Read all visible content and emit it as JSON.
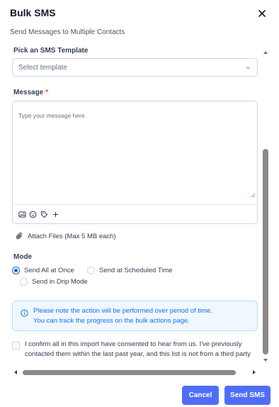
{
  "header": {
    "title": "Bulk SMS",
    "subtitle": "Send Messages to Multiple Contacts",
    "close_icon": "close-icon"
  },
  "template": {
    "label": "Pick an SMS Template",
    "placeholder": "Select template"
  },
  "message": {
    "label": "Message",
    "required_mark": "*",
    "placeholder": "Type your message here",
    "toolbar_icons": [
      "image-icon",
      "emoji-icon",
      "tag-icon",
      "plus-icon"
    ]
  },
  "attach": {
    "label": "Attach Files (Max 5 MB each)"
  },
  "mode": {
    "label": "Mode",
    "options": [
      {
        "label": "Send All at Once",
        "checked": true
      },
      {
        "label": "Send at Scheduled Time",
        "checked": false
      },
      {
        "label": "Send in Drip Mode",
        "checked": false
      }
    ]
  },
  "notice": {
    "line1": "Please note the action will be performed over period of time.",
    "line2": "You can track the progress on the bulk actions page."
  },
  "consent": {
    "text": "I confirm all in this import have consented to hear from us. I've previously contacted them within the last past year, and this list is not from a third party",
    "checked": false
  },
  "footer": {
    "cancel_label": "Cancel",
    "send_label": "Send SMS"
  },
  "colors": {
    "primary": "#4f6ef7",
    "info_bg": "#eff8ff",
    "info_text": "#1570ef",
    "required": "#f04438"
  }
}
